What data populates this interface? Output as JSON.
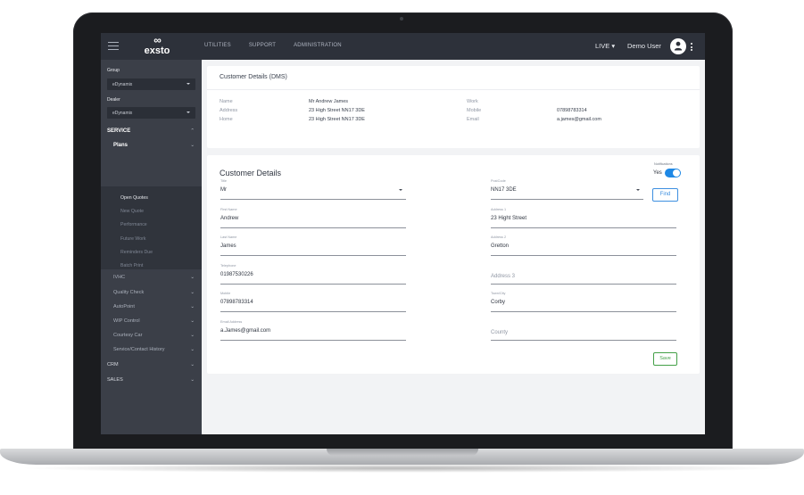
{
  "topbar": {
    "logo_text": "exsto",
    "menu": [
      "UTILITIES",
      "SUPPORT",
      "ADMINISTRATION"
    ],
    "env_label": "LIVE ▾",
    "user_name": "Demo User"
  },
  "sidebar": {
    "group_label": "Group",
    "group_value": "eDynamix",
    "dealer_label": "Dealer",
    "dealer_value": "eDynamix",
    "service_label": "SERVICE",
    "plans_label": "Plans",
    "plans_items": [
      "Open Quotes",
      "New Quote",
      "Performance",
      "Future Work",
      "Reminders Due",
      "Batch Print"
    ],
    "service_items": [
      "IVHC",
      "Quality Check",
      "AutoPoint",
      "WIP Control",
      "Courtesy Car",
      "Service/Contact History"
    ],
    "crm_label": "CRM",
    "sales_label": "SALES"
  },
  "dms_card": {
    "title": "Customer Details (DMS)",
    "left": [
      {
        "label": "Name",
        "value": "Mr Andrew James"
      },
      {
        "label": "Address",
        "value": "23 High Street NN17 3DE"
      },
      {
        "label": "Home",
        "value": "23 High Street NN17 3DE"
      }
    ],
    "right": [
      {
        "label": "Work",
        "value": ""
      },
      {
        "label": "Mobile",
        "value": "07898783314"
      },
      {
        "label": "Email",
        "value": "a.james@gmail.com"
      }
    ]
  },
  "customer_card": {
    "title": "Customer Details",
    "notifications_label": "Notifications",
    "notifications_value": "Yes",
    "notifications_on": true,
    "find_label": "Find",
    "save_label": "Save",
    "left_fields": [
      {
        "label": "Title",
        "value": "Mr",
        "dropdown": true
      },
      {
        "label": "First Name",
        "value": "Andrew"
      },
      {
        "label": "Last Name",
        "value": "James"
      },
      {
        "label": "Telephone",
        "value": "01987530226"
      },
      {
        "label": "Mobile",
        "value": "07898783314"
      },
      {
        "label": "Email Address",
        "value": "a.James@gmail.com"
      }
    ],
    "right_fields": [
      {
        "label": "PostCode",
        "value": "NN17 3DE",
        "dropdown": true
      },
      {
        "label": "Address 1",
        "value": "23 Hight Street"
      },
      {
        "label": "Address 2",
        "value": "Gretton"
      },
      {
        "label": "",
        "placeholder": "Address 3"
      },
      {
        "label": "Town/City",
        "value": "Corby"
      },
      {
        "label": "",
        "placeholder": "County"
      }
    ]
  },
  "colors": {
    "topbar": "#2d313a",
    "sidebar": "#3b3f48",
    "accent_blue": "#1e88e5",
    "save_green": "#43a047"
  }
}
